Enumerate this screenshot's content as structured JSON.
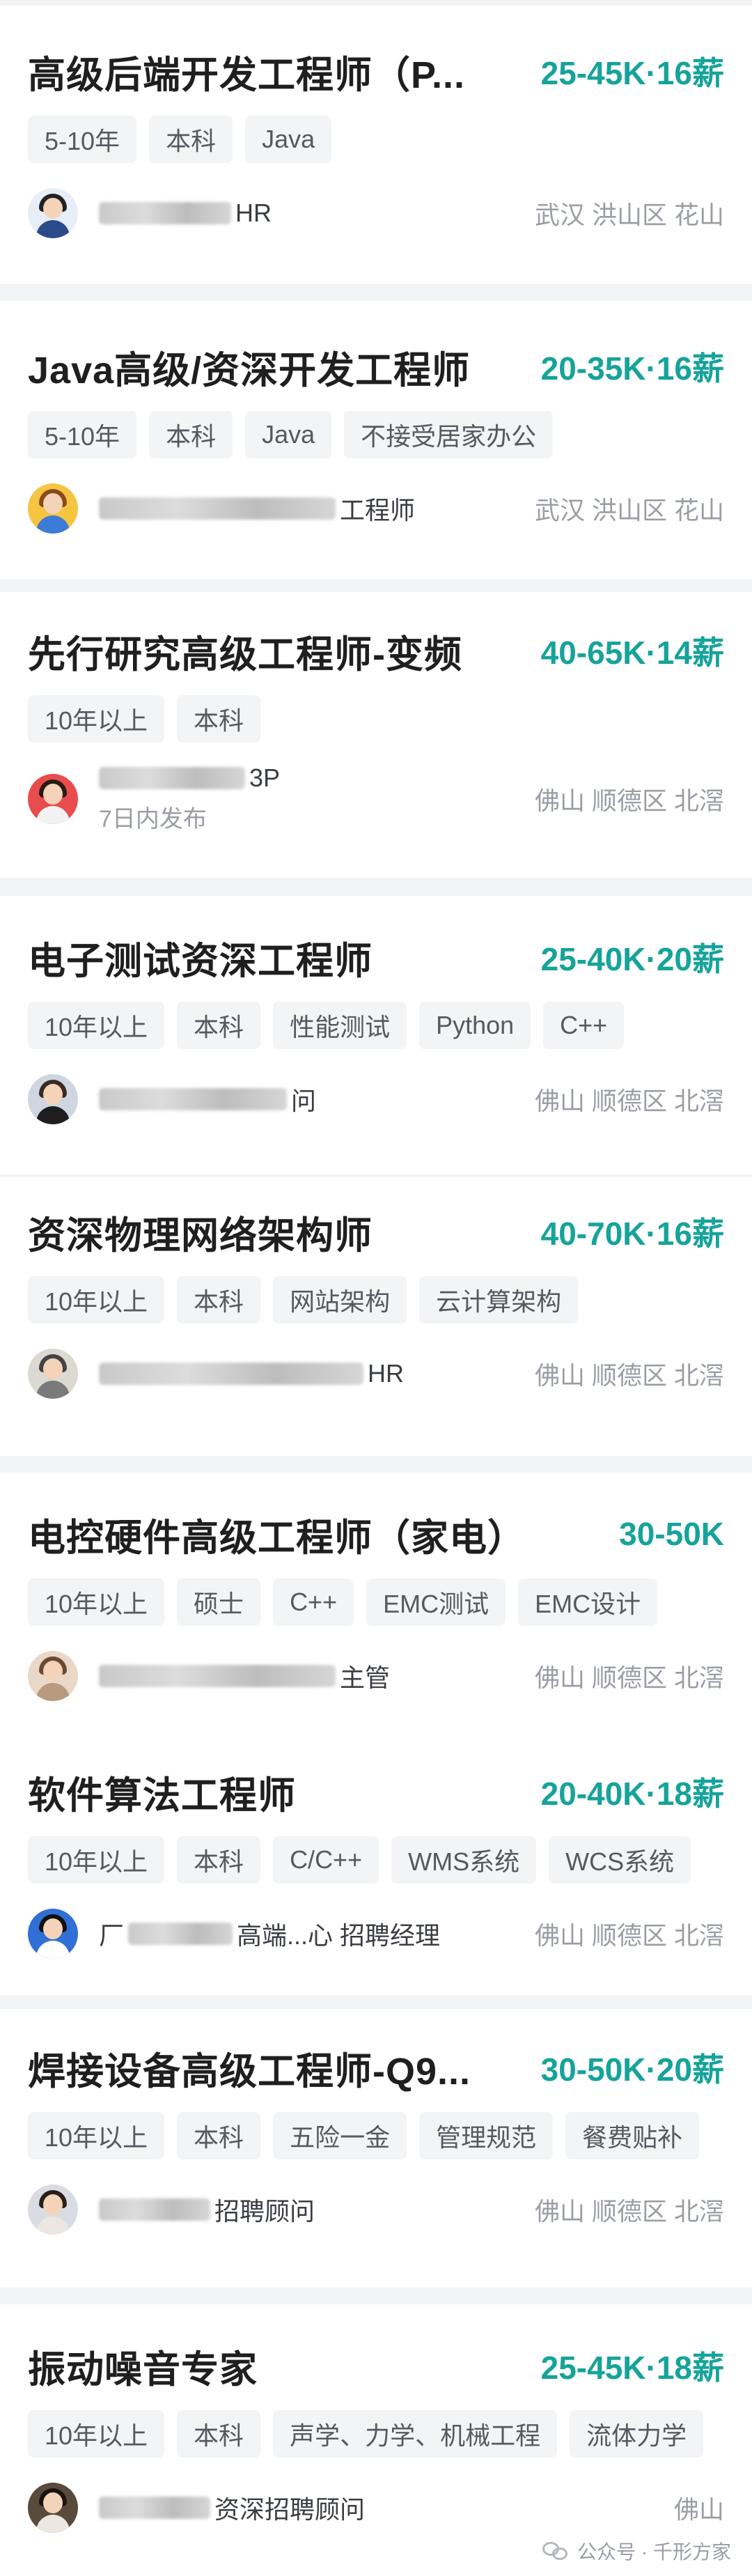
{
  "jobs": [
    {
      "title": "高级后端开发工程师（P...",
      "salary": "25-45K·16薪",
      "tags": [
        "5-10年",
        "本科",
        "Java"
      ],
      "recruiter_suffix": "HR",
      "recruiter_sub": "",
      "location": "武汉  洪山区  花山",
      "avatar": "woman-black-hair-avatar"
    },
    {
      "title": "Java高级/资深开发工程师",
      "salary": "20-35K·16薪",
      "tags": [
        "5-10年",
        "本科",
        "Java",
        "不接受居家办公"
      ],
      "recruiter_suffix": "工程师",
      "recruiter_sub": "",
      "location": "武汉  洪山区  花山",
      "avatar": "man-glasses-avatar"
    },
    {
      "title": "先行研究高级工程师-变频",
      "salary": "40-65K·14薪",
      "tags": [
        "10年以上",
        "本科"
      ],
      "recruiter_suffix": "3P",
      "recruiter_sub": "7日内发布",
      "location": "佛山  顺德区  北滘",
      "avatar": "woman-red-avatar"
    },
    {
      "title": "电子测试资深工程师",
      "salary": "25-40K·20薪",
      "tags": [
        "10年以上",
        "本科",
        "性能测试",
        "Python",
        "C++"
      ],
      "recruiter_suffix": "问",
      "recruiter_sub": "",
      "location": "佛山  顺德区  北滘",
      "avatar": "woman-photo-avatar"
    },
    {
      "title": "资深物理网络架构师",
      "salary": "40-70K·16薪",
      "tags": [
        "10年以上",
        "本科",
        "网站架构",
        "云计算架构"
      ],
      "recruiter_suffix": "HR",
      "recruiter_sub": "",
      "location": "佛山  顺德区  北滘",
      "avatar": "woman-photo-avatar-2"
    },
    {
      "title": "电控硬件高级工程师（家电）",
      "salary": "30-50K",
      "tags": [
        "10年以上",
        "硕士",
        "C++",
        "EMC测试",
        "EMC设计"
      ],
      "recruiter_suffix": "主管",
      "recruiter_sub": "",
      "location": "佛山  顺德区  北滘",
      "avatar": "woman-photo-avatar-3"
    },
    {
      "title": "软件算法工程师",
      "salary": "20-40K·18薪",
      "tags": [
        "10年以上",
        "本科",
        "C/C++",
        "WMS系统",
        "WCS系统"
      ],
      "recruiter_suffix": "高端...心 招聘经理",
      "recruiter_sub": "",
      "location": "佛山  顺德区  北滘",
      "avatar": "woman-blue-avatar"
    },
    {
      "title": "焊接设备高级工程师-Q9...",
      "salary": "30-50K·20薪",
      "tags": [
        "10年以上",
        "本科",
        "五险一金",
        "管理规范",
        "餐费贴补"
      ],
      "recruiter_suffix": "招聘顾问",
      "recruiter_sub": "",
      "location": "佛山  顺德区  北滘",
      "avatar": "woman-photo-avatar-4"
    },
    {
      "title": "振动噪音专家",
      "salary": "25-45K·18薪",
      "tags": [
        "10年以上",
        "本科",
        "声学、力学、机械工程",
        "流体力学"
      ],
      "recruiter_suffix": "资深招聘顾问",
      "recruiter_sub": "",
      "location": "佛山",
      "avatar": "woman-photo-avatar-5"
    }
  ],
  "watermark": "公众号 · 千形方家",
  "colors": {
    "salary": "#16a39a",
    "title": "#1f1f1f",
    "tag_bg": "#f3f4f6",
    "page_bg": "#f2f3f5"
  }
}
